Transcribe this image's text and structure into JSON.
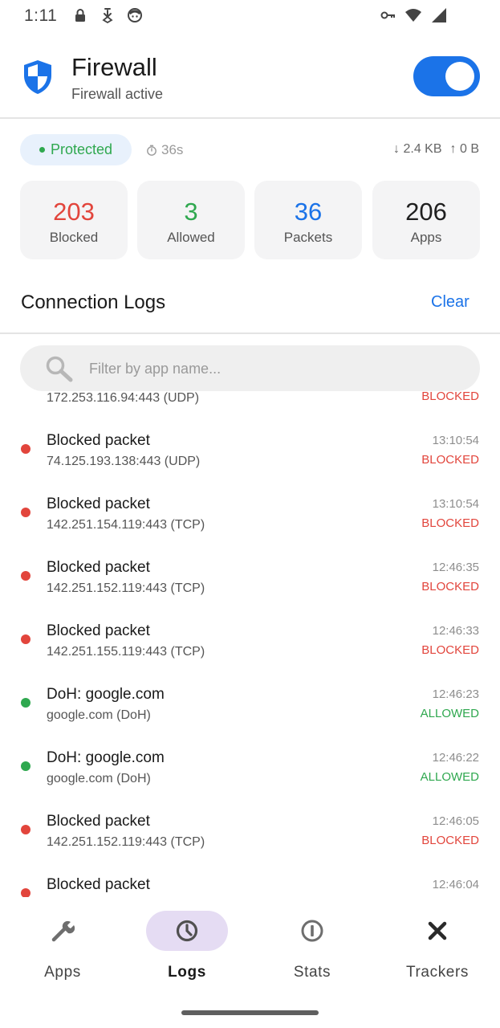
{
  "status_bar": {
    "time": "1:11",
    "left_icons": [
      "lock-icon",
      "download-icon",
      "face-icon"
    ],
    "right_icons": [
      "vpn-key-icon",
      "wifi-icon",
      "signal-icon"
    ]
  },
  "header": {
    "title": "Firewall",
    "subtitle": "Firewall active",
    "toggle_on": true,
    "accent_color": "#1b73e8"
  },
  "status": {
    "badge": "Protected",
    "uptime": "36s",
    "download": "↓ 2.4 KB",
    "upload": "↑ 0 B"
  },
  "stats": [
    {
      "value": "203",
      "label": "Blocked",
      "color": "#e2453c"
    },
    {
      "value": "3",
      "label": "Allowed",
      "color": "#2fa84f"
    },
    {
      "value": "36",
      "label": "Packets",
      "color": "#1b73e8"
    },
    {
      "value": "206",
      "label": "Apps",
      "color": "#1f1f1f"
    }
  ],
  "logs_section": {
    "title": "Connection Logs",
    "clear_label": "Clear",
    "search_placeholder": "Filter by app name..."
  },
  "logs": [
    {
      "title": "",
      "detail": "172.253.116.94:443 (UDP)",
      "time": "",
      "status": "BLOCKED",
      "kind": "blocked"
    },
    {
      "title": "Blocked packet",
      "detail": "74.125.193.138:443 (UDP)",
      "time": "13:10:54",
      "status": "BLOCKED",
      "kind": "blocked"
    },
    {
      "title": "Blocked packet",
      "detail": "142.251.154.119:443 (TCP)",
      "time": "13:10:54",
      "status": "BLOCKED",
      "kind": "blocked"
    },
    {
      "title": "Blocked packet",
      "detail": "142.251.152.119:443 (TCP)",
      "time": "12:46:35",
      "status": "BLOCKED",
      "kind": "blocked"
    },
    {
      "title": "Blocked packet",
      "detail": "142.251.155.119:443 (TCP)",
      "time": "12:46:33",
      "status": "BLOCKED",
      "kind": "blocked"
    },
    {
      "title": "DoH: google.com",
      "detail": "google.com (DoH)",
      "time": "12:46:23",
      "status": "ALLOWED",
      "kind": "allowed"
    },
    {
      "title": "DoH: google.com",
      "detail": "google.com (DoH)",
      "time": "12:46:22",
      "status": "ALLOWED",
      "kind": "allowed"
    },
    {
      "title": "Blocked packet",
      "detail": "142.251.152.119:443 (TCP)",
      "time": "12:46:05",
      "status": "BLOCKED",
      "kind": "blocked"
    },
    {
      "title": "Blocked packet",
      "detail": "",
      "time": "12:46:04",
      "status": "",
      "kind": "blocked"
    }
  ],
  "colors": {
    "blocked": "#e2453c",
    "allowed": "#2fa84f"
  },
  "nav": [
    {
      "label": "Apps",
      "icon": "wrench-icon",
      "active": false
    },
    {
      "label": "Logs",
      "icon": "clock-icon",
      "active": true
    },
    {
      "label": "Stats",
      "icon": "info-icon",
      "active": false
    },
    {
      "label": "Trackers",
      "icon": "close-icon",
      "active": false
    }
  ]
}
